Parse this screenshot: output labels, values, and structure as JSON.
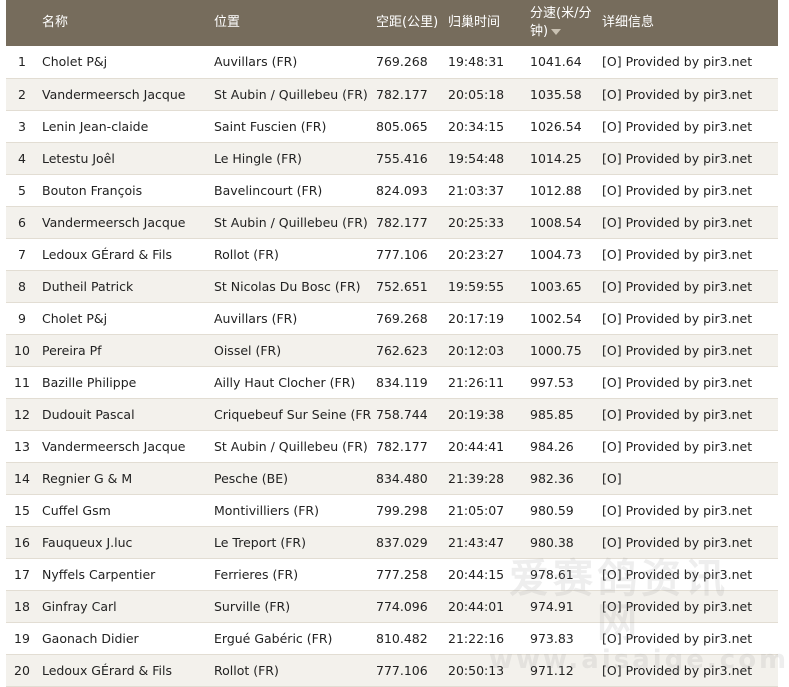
{
  "table": {
    "headers": {
      "rank": "",
      "name": "名称",
      "location": "位置",
      "distance": "空距(公里)",
      "time": "归巢时间",
      "speed": "分速(米/分钟)",
      "details": "详细信息"
    },
    "rows": [
      {
        "rank": "1",
        "name": "Cholet P&j",
        "location": "Auvillars (FR)",
        "distance": "769.268",
        "time": "19:48:31",
        "speed": "1041.64",
        "details": "[O] Provided by pir3.net"
      },
      {
        "rank": "2",
        "name": "Vandermeersch Jacque",
        "location": "St Aubin / Quillebeu (FR)",
        "distance": "782.177",
        "time": "20:05:18",
        "speed": "1035.58",
        "details": "[O] Provided by pir3.net"
      },
      {
        "rank": "3",
        "name": "Lenin Jean-claide",
        "location": "Saint Fuscien (FR)",
        "distance": "805.065",
        "time": "20:34:15",
        "speed": "1026.54",
        "details": "[O] Provided by pir3.net"
      },
      {
        "rank": "4",
        "name": "Letestu Joêl",
        "location": "Le Hingle (FR)",
        "distance": "755.416",
        "time": "19:54:48",
        "speed": "1014.25",
        "details": "[O] Provided by pir3.net"
      },
      {
        "rank": "5",
        "name": "Bouton François",
        "location": "Bavelincourt (FR)",
        "distance": "824.093",
        "time": "21:03:37",
        "speed": "1012.88",
        "details": "[O] Provided by pir3.net"
      },
      {
        "rank": "6",
        "name": "Vandermeersch Jacque",
        "location": "St Aubin / Quillebeu (FR)",
        "distance": "782.177",
        "time": "20:25:33",
        "speed": "1008.54",
        "details": "[O] Provided by pir3.net"
      },
      {
        "rank": "7",
        "name": "Ledoux GÉrard & Fils",
        "location": "Rollot (FR)",
        "distance": "777.106",
        "time": "20:23:27",
        "speed": "1004.73",
        "details": "[O] Provided by pir3.net"
      },
      {
        "rank": "8",
        "name": "Dutheil Patrick",
        "location": "St Nicolas Du Bosc (FR)",
        "distance": "752.651",
        "time": "19:59:55",
        "speed": "1003.65",
        "details": "[O] Provided by pir3.net"
      },
      {
        "rank": "9",
        "name": "Cholet P&j",
        "location": "Auvillars (FR)",
        "distance": "769.268",
        "time": "20:17:19",
        "speed": "1002.54",
        "details": "[O] Provided by pir3.net"
      },
      {
        "rank": "10",
        "name": "Pereira Pf",
        "location": "Oissel (FR)",
        "distance": "762.623",
        "time": "20:12:03",
        "speed": "1000.75",
        "details": "[O] Provided by pir3.net"
      },
      {
        "rank": "11",
        "name": "Bazille Philippe",
        "location": "Ailly Haut Clocher (FR)",
        "distance": "834.119",
        "time": "21:26:11",
        "speed": "997.53",
        "details": "[O] Provided by pir3.net"
      },
      {
        "rank": "12",
        "name": "Dudouit Pascal",
        "location": "Criquebeuf Sur Seine (FR)",
        "distance": "758.744",
        "time": "20:19:38",
        "speed": "985.85",
        "details": "[O] Provided by pir3.net"
      },
      {
        "rank": "13",
        "name": "Vandermeersch Jacque",
        "location": "St Aubin / Quillebeu (FR)",
        "distance": "782.177",
        "time": "20:44:41",
        "speed": "984.26",
        "details": "[O] Provided by pir3.net"
      },
      {
        "rank": "14",
        "name": "Regnier G & M",
        "location": "Pesche (BE)",
        "distance": "834.480",
        "time": "21:39:28",
        "speed": "982.36",
        "details": "[O]"
      },
      {
        "rank": "15",
        "name": "Cuffel Gsm",
        "location": "Montivilliers (FR)",
        "distance": "799.298",
        "time": "21:05:07",
        "speed": "980.59",
        "details": "[O] Provided by pir3.net"
      },
      {
        "rank": "16",
        "name": "Fauqueux J.luc",
        "location": "Le Treport (FR)",
        "distance": "837.029",
        "time": "21:43:47",
        "speed": "980.38",
        "details": "[O] Provided by pir3.net"
      },
      {
        "rank": "17",
        "name": "Nyffels Carpentier",
        "location": "Ferrieres (FR)",
        "distance": "777.258",
        "time": "20:44:15",
        "speed": "978.61",
        "details": "[O] Provided by pir3.net"
      },
      {
        "rank": "18",
        "name": "Ginfray Carl",
        "location": "Surville (FR)",
        "distance": "774.096",
        "time": "20:44:01",
        "speed": "974.91",
        "details": "[O] Provided by pir3.net"
      },
      {
        "rank": "19",
        "name": "Gaonach Didier",
        "location": "Ergué Gabéric (FR)",
        "distance": "810.482",
        "time": "21:22:16",
        "speed": "973.83",
        "details": "[O] Provided by pir3.net"
      },
      {
        "rank": "20",
        "name": "Ledoux GÉrard & Fils",
        "location": "Rollot (FR)",
        "distance": "777.106",
        "time": "20:50:13",
        "speed": "971.12",
        "details": "[O] Provided by pir3.net"
      }
    ]
  },
  "sort": {
    "column": "speed",
    "direction": "descending",
    "icon": "sort-down-arrow-icon"
  },
  "watermark": {
    "line1": "爱赛鸽资讯网",
    "line2": "www.aisaige.com"
  },
  "colors": {
    "header_bg": "#766c5c",
    "header_text": "#ffffff",
    "row_alt": "#f3f1ec",
    "row_border": "#e2ddd3"
  }
}
